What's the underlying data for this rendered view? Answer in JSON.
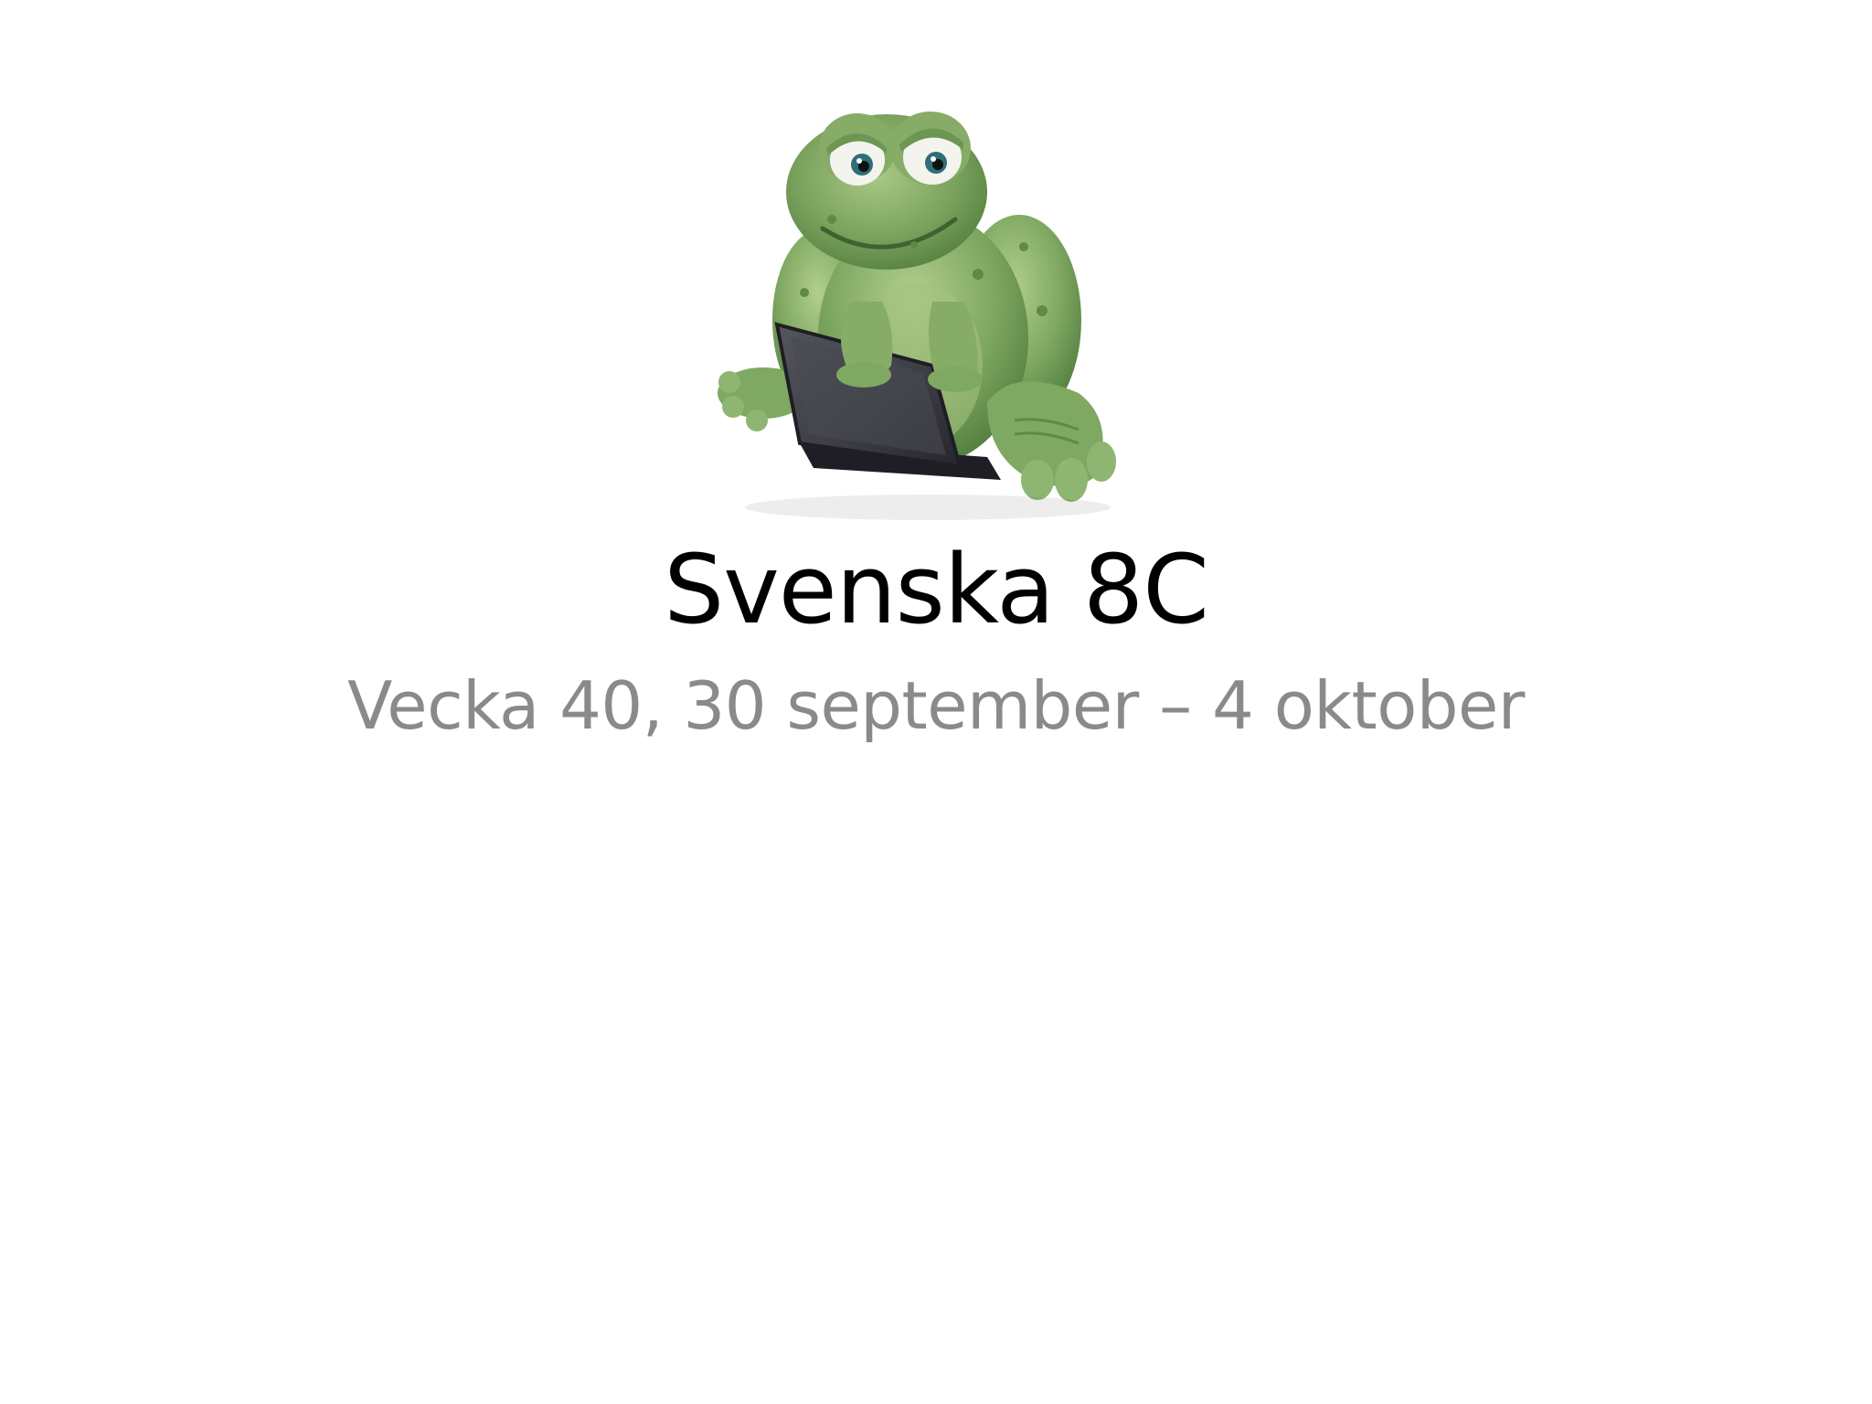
{
  "slide": {
    "title": "Svenska 8C",
    "subtitle": "Vecka 40, 30 september – 4 oktober",
    "image": {
      "subject": "frog-with-laptop",
      "colors": {
        "frog_body": "#7fa862",
        "frog_shadow": "#4e7a3a",
        "frog_highlight": "#b2cf8d",
        "eye_white": "#f4f4ee",
        "iris": "#2f6d7a",
        "laptop": "#3c3c44",
        "laptop_edge": "#1e1e24"
      }
    }
  },
  "theme": {
    "background": "#ffffff",
    "title_color": "#000000",
    "subtitle_color": "#8a8a8a"
  }
}
